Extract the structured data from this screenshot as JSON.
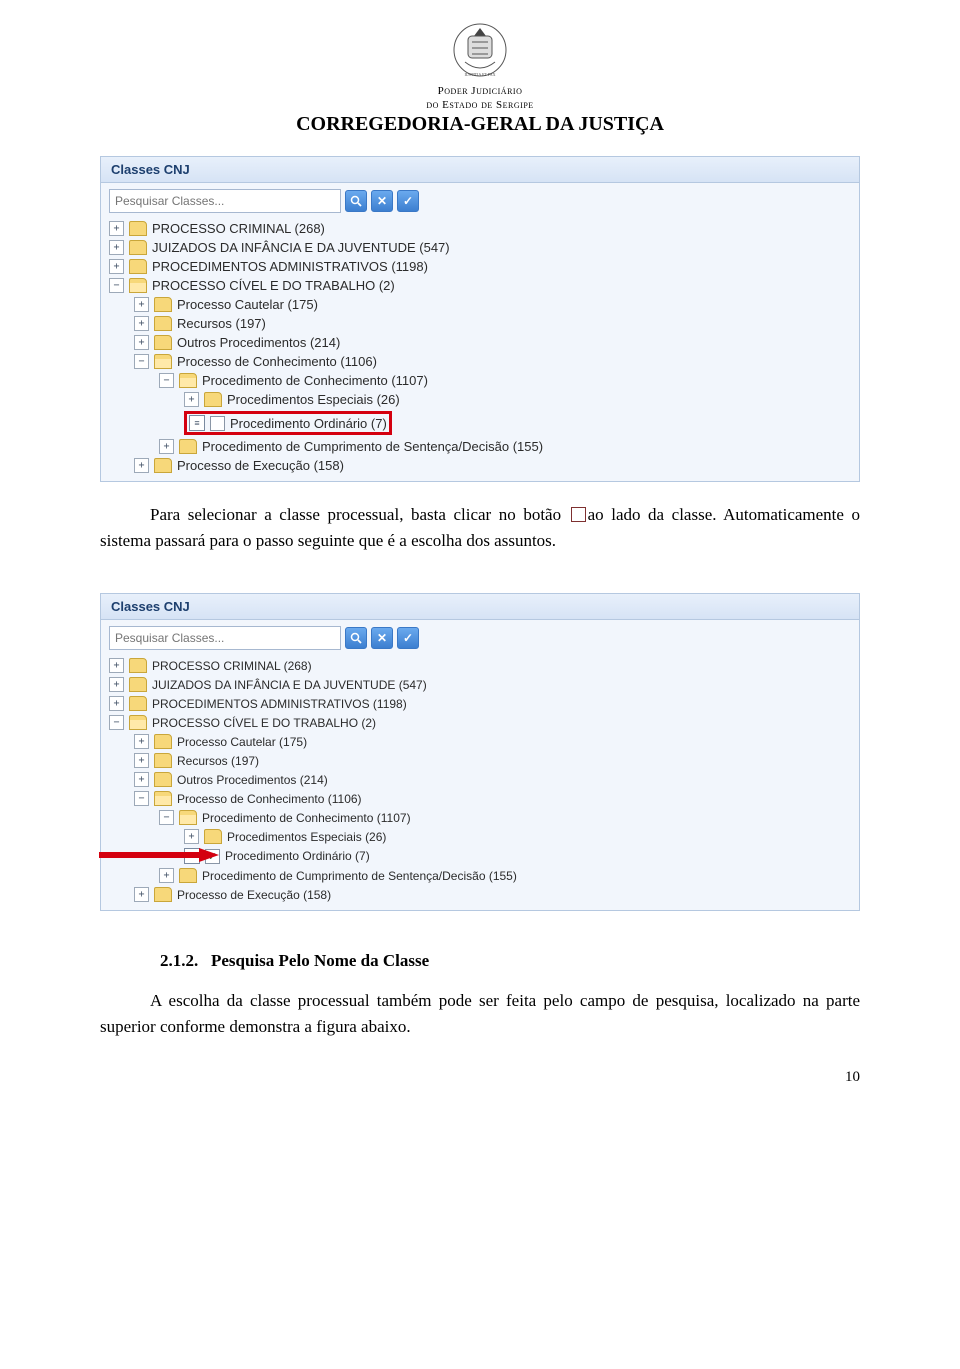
{
  "header": {
    "line1": "Poder Judiciário",
    "line2": "do Estado de Sergipe",
    "title": "CORREGEDORIA-GERAL DA JUSTIÇA"
  },
  "panel": {
    "title": "Classes CNJ",
    "search_placeholder": "Pesquisar Classes...",
    "tree": {
      "n0": "PROCESSO CRIMINAL (268)",
      "n1": "JUIZADOS DA INFÂNCIA E DA JUVENTUDE (547)",
      "n2": "PROCEDIMENTOS ADMINISTRATIVOS (1198)",
      "n3": "PROCESSO CÍVEL E DO TRABALHO (2)",
      "n3_0": "Processo Cautelar (175)",
      "n3_1": "Recursos (197)",
      "n3_2": "Outros Procedimentos (214)",
      "n3_3": "Processo de Conhecimento (1106)",
      "n3_3_0": "Procedimento de Conhecimento (1107)",
      "n3_3_0_0": "Procedimentos Especiais (26)",
      "n3_3_0_1": "Procedimento Ordinário (7)",
      "n3_3_1": "Procedimento de Cumprimento de Sentença/Decisão (155)",
      "n3_4": "Processo de Execução (158)"
    }
  },
  "para1": {
    "t1": "Para selecionar a classe processual, basta clicar no botão ",
    "t2": "ao lado da classe. Automaticamente",
    "t3": "o sistema passará para o passo seguinte que é a escolha dos assuntos."
  },
  "section": {
    "num": "2.1.2.",
    "title": "Pesquisa Pelo Nome da Classe",
    "body": "A escolha da classe processual também pode ser feita pelo campo de pesquisa, localizado na parte superior conforme demonstra a figura abaixo."
  },
  "page_number": "10"
}
